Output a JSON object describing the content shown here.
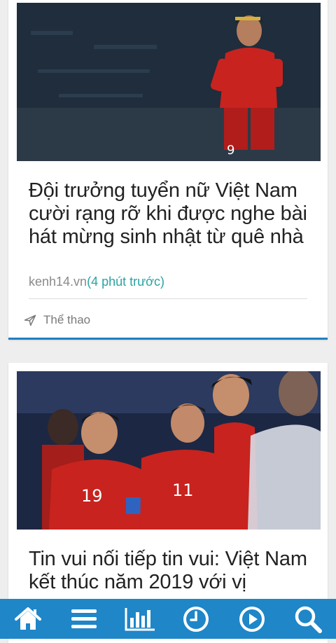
{
  "articles": [
    {
      "title": "Đội trưởng tuyển nữ Việt Nam cười rạng rỡ khi được nghe bài hát mừng sinh nhật từ quê nhà",
      "source": "kenh14.vn",
      "time": "(4 phút trước)",
      "category": "Thể thao",
      "jersey_number": "9"
    },
    {
      "title": "Tin vui nối tiếp tin vui: Việt Nam kết thúc năm 2019 với vị",
      "jersey_numbers": [
        "19",
        "11"
      ]
    }
  ],
  "bottom_nav": {
    "items": [
      "home-icon",
      "menu-icon",
      "chart-icon",
      "clock-icon",
      "play-icon",
      "search-icon"
    ]
  },
  "colors": {
    "accent": "#1f86c8",
    "time": "#2aa3a3",
    "jersey": "#c8231e"
  }
}
